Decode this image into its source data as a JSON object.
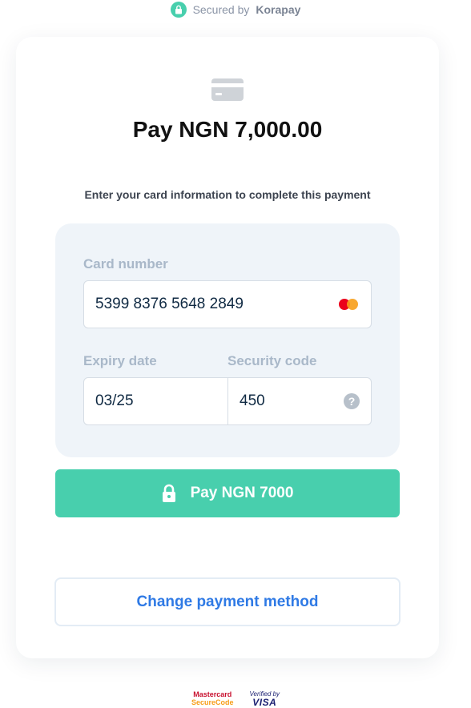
{
  "header": {
    "secured_prefix": "Secured by",
    "secured_brand": "Korapay",
    "lock_icon": "lock-icon"
  },
  "payment": {
    "title": "Pay NGN 7,000.00",
    "subtitle": "Enter your card information to complete this payment",
    "card_icon": "credit-card-icon"
  },
  "form": {
    "card_number_label": "Card number",
    "card_number_value": "5399 8376 5648 2849",
    "card_brand": "mastercard-icon",
    "expiry_label": "Expiry date",
    "expiry_value": "03/25",
    "security_label": "Security code",
    "security_value": "450",
    "help_icon": "help-icon",
    "help_glyph": "?"
  },
  "buttons": {
    "pay_label": "Pay NGN 7000",
    "change_label": "Change payment method"
  },
  "footer": {
    "mastercard_line1": "Mastercard",
    "mastercard_line2": "SecureCode",
    "visa_line1": "Verified by",
    "visa_line2": "VISA"
  },
  "colors": {
    "accent": "#48cfad",
    "link": "#2f7ae5",
    "form_bg": "#eff4f9"
  }
}
